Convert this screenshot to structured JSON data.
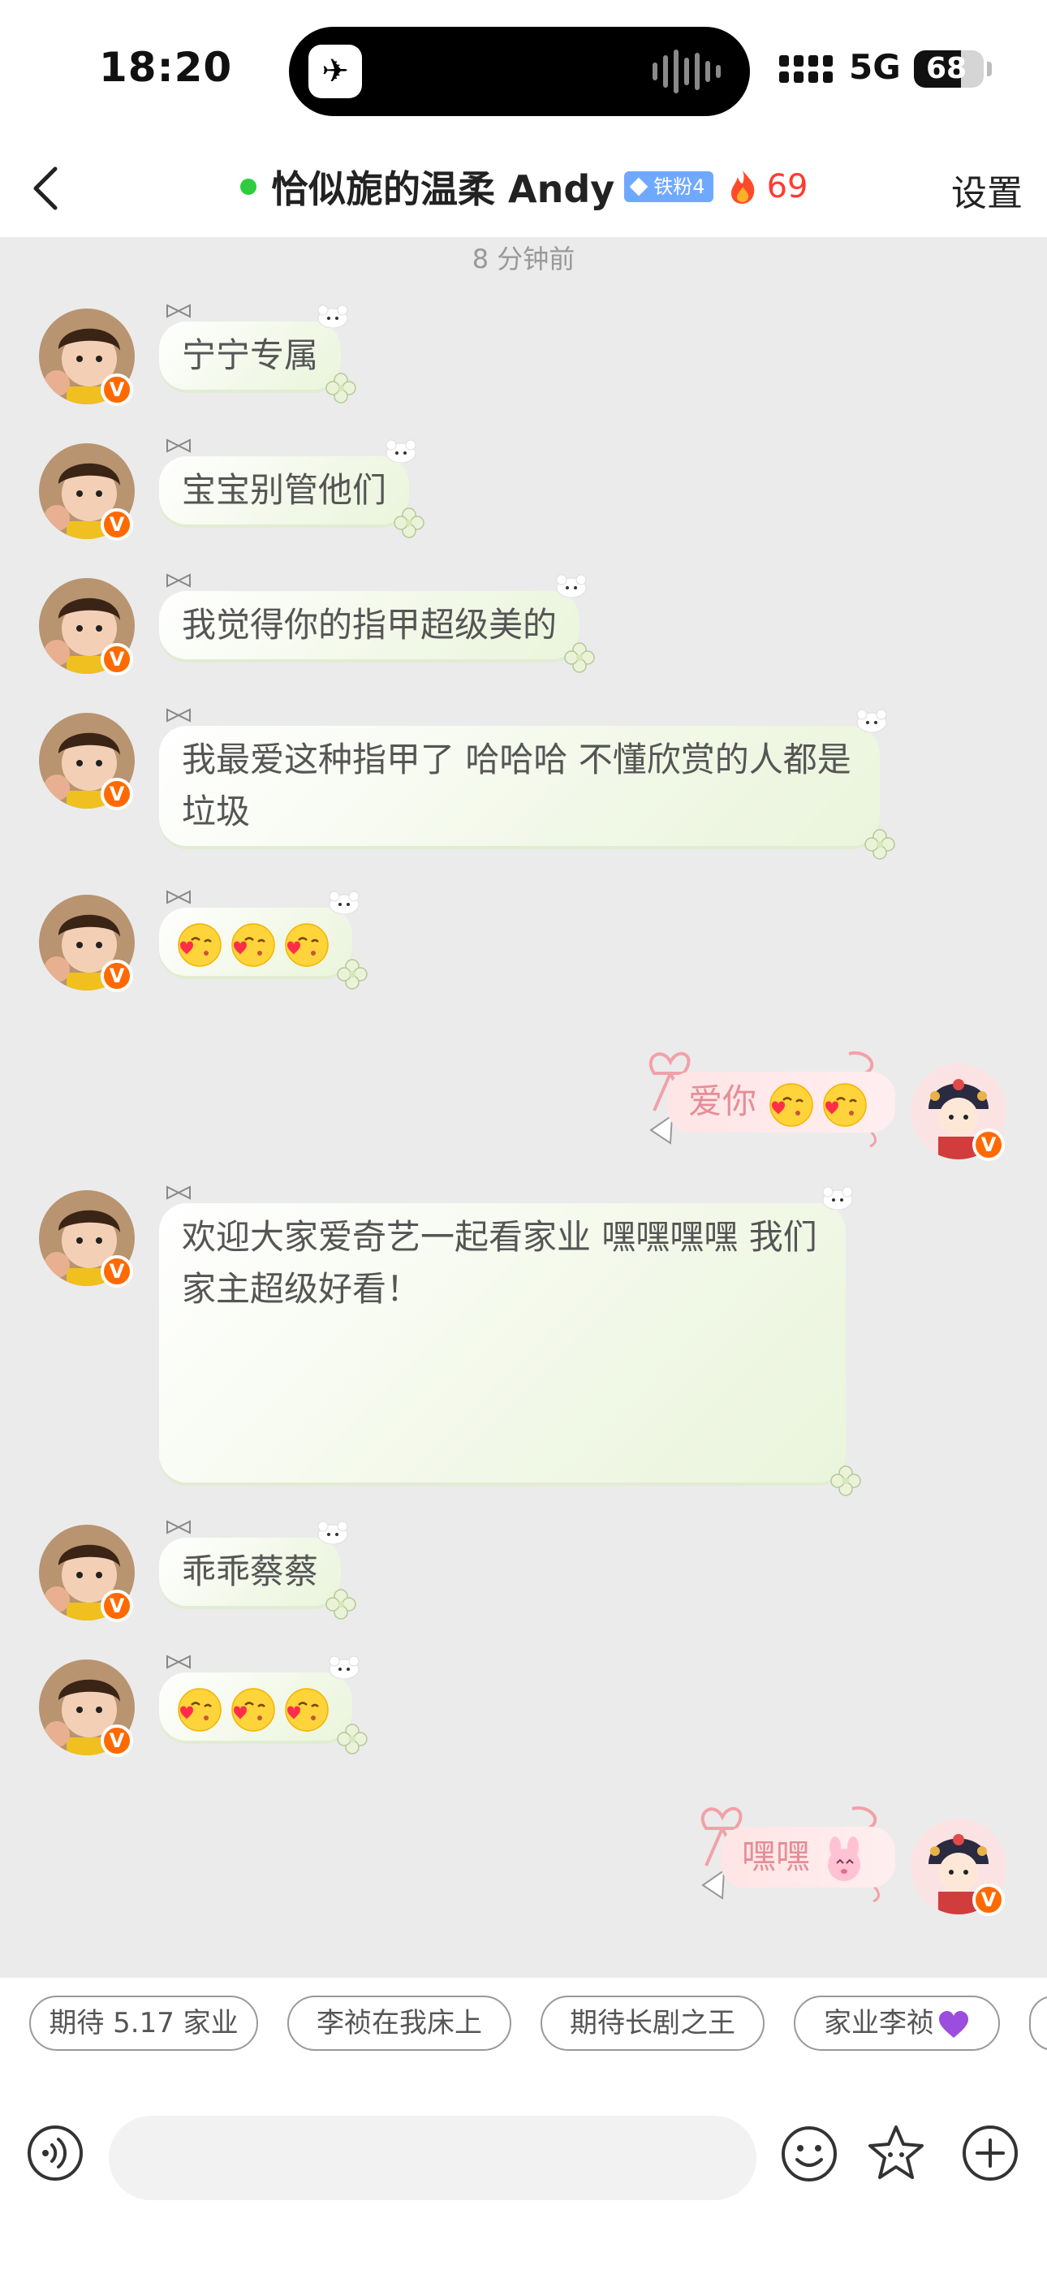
{
  "status_bar": {
    "time": "18:20",
    "network": "5G",
    "battery": "68",
    "battery_level": 0.68
  },
  "header": {
    "contact_name": "恰似旎的温柔 Andy",
    "fan_badge": "铁粉4",
    "streak_count": "69",
    "settings_label": "设置"
  },
  "chat": {
    "time_divider": "8 分钟前",
    "messages": [
      {
        "side": "left",
        "text": "宁宁专属"
      },
      {
        "side": "left",
        "text": "宝宝别管他们"
      },
      {
        "side": "left",
        "text": "我觉得你的指甲超级美的"
      },
      {
        "side": "left",
        "text": "我最爱这种指甲了 哈哈哈 不懂欣赏的人都是垃圾"
      },
      {
        "side": "left",
        "emoji_count": 3,
        "emoji": "kiss-heart"
      },
      {
        "side": "right",
        "text": "爱你",
        "emoji_count": 2,
        "emoji": "kiss-heart"
      },
      {
        "side": "left",
        "text": "欢迎大家爱奇艺一起看家业 嘿嘿嘿嘿 我们家主超级好看！"
      },
      {
        "side": "left",
        "text": "乖乖蔡蔡"
      },
      {
        "side": "left",
        "emoji_count": 3,
        "emoji": "kiss-heart"
      },
      {
        "side": "right",
        "text": "嘿嘿",
        "emoji": "pink-bunny"
      }
    ]
  },
  "quick_replies": [
    "期待 5.17 家业",
    "李祯在我床上",
    "期待长剧之王",
    "家业李祯"
  ],
  "input": {
    "placeholder": ""
  },
  "colors": {
    "accent_orange": "#ff6a00",
    "online_green": "#2ecc40",
    "streak_red": "#ff3b30",
    "fan_badge_blue": "#6fa9ff",
    "pink_text": "#e58e97"
  }
}
